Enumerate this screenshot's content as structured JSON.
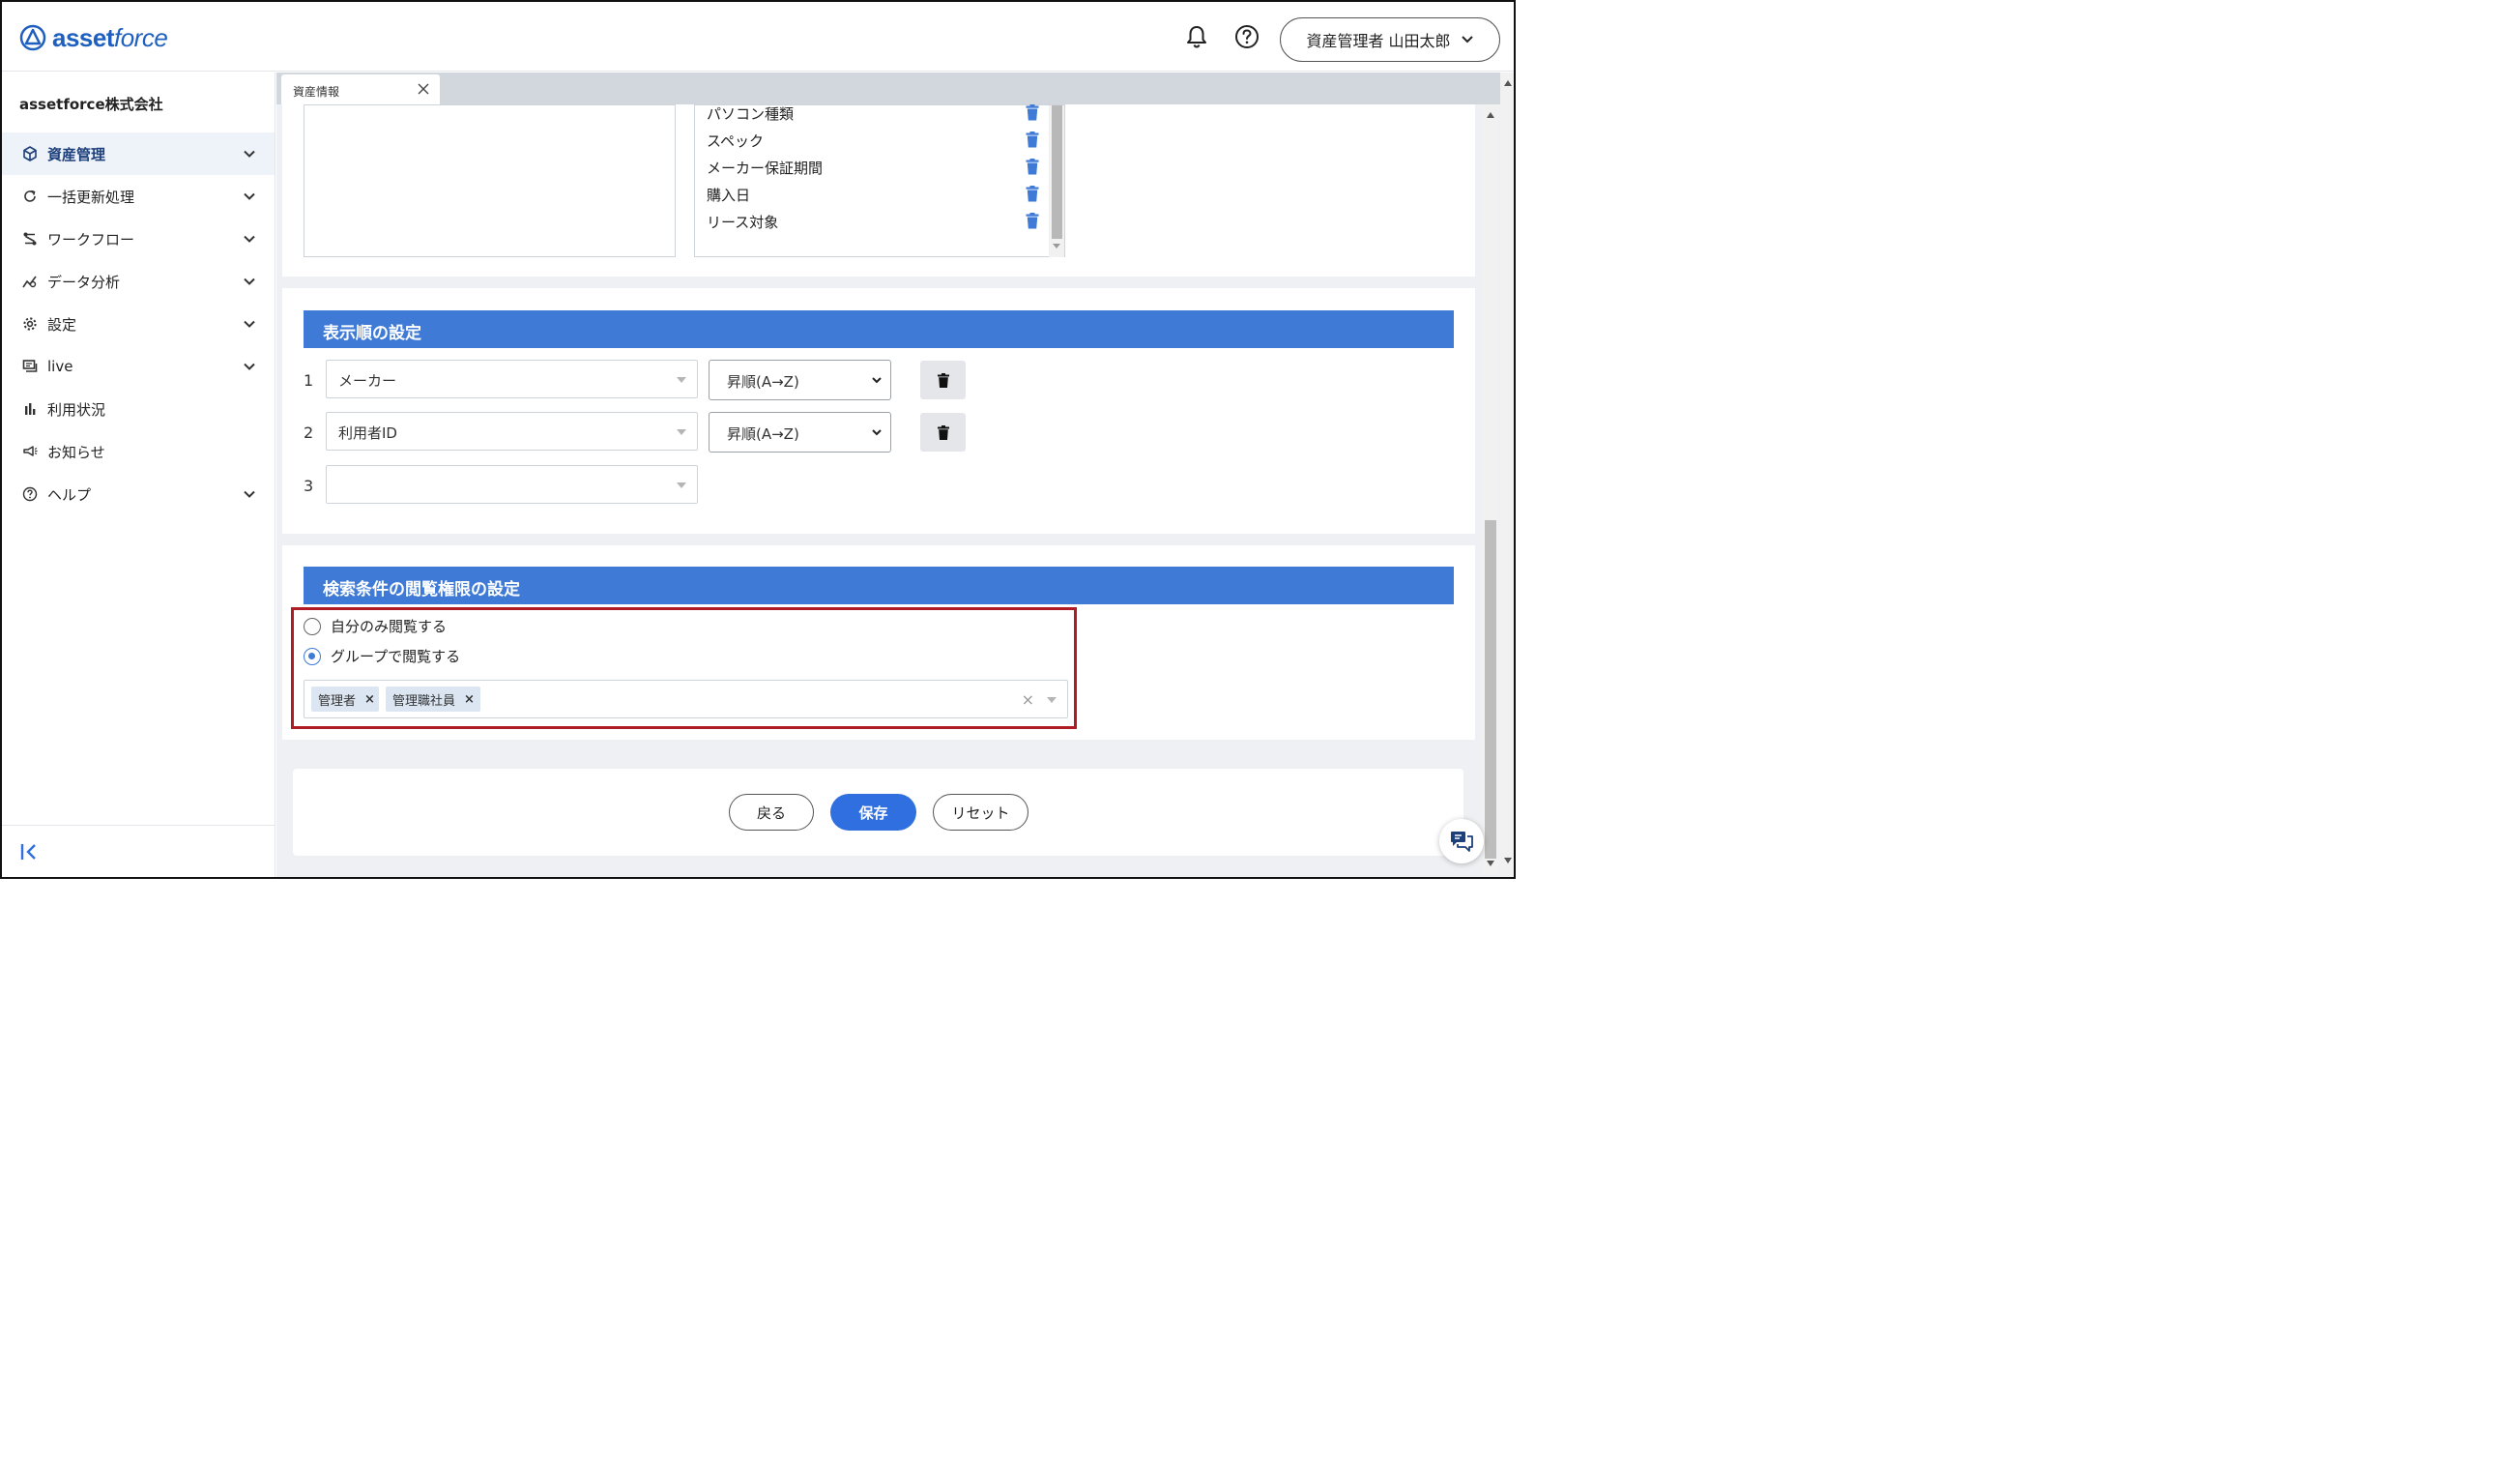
{
  "header": {
    "logo_text_bold": "asset",
    "logo_text_italic": "force",
    "user_label": "資産管理者 山田太郎"
  },
  "sidebar": {
    "company": "assetforce株式会社",
    "items": [
      {
        "label": "資産管理",
        "icon": "cube-icon",
        "active": true,
        "expandable": true
      },
      {
        "label": "一括更新処理",
        "icon": "refresh-icon",
        "expandable": true
      },
      {
        "label": "ワークフロー",
        "icon": "workflow-icon",
        "expandable": true
      },
      {
        "label": "データ分析",
        "icon": "analytics-icon",
        "expandable": true
      },
      {
        "label": "設定",
        "icon": "gear-icon",
        "expandable": true
      },
      {
        "label": "live",
        "icon": "live-icon",
        "expandable": true
      },
      {
        "label": "利用状況",
        "icon": "bar-chart-icon",
        "expandable": false
      },
      {
        "label": "お知らせ",
        "icon": "megaphone-icon",
        "expandable": false
      },
      {
        "label": "ヘルプ",
        "icon": "help-circle-icon",
        "expandable": true
      }
    ]
  },
  "tabs": [
    {
      "label": "資産情報"
    }
  ],
  "fields_list": {
    "items": [
      "パソコン種類",
      "スペック",
      "メーカー保証期間",
      "購入日",
      "リース対象"
    ]
  },
  "sort_section": {
    "title": "表示順の設定",
    "rows": [
      {
        "num": "1",
        "field": "メーカー",
        "order": "昇順(A→Z)"
      },
      {
        "num": "2",
        "field": "利用者ID",
        "order": "昇順(A→Z)"
      },
      {
        "num": "3",
        "field": "",
        "order": ""
      }
    ]
  },
  "permission_section": {
    "title": "検索条件の閲覧権限の設定",
    "options": [
      {
        "label": "自分のみ閲覧する",
        "checked": false
      },
      {
        "label": "グループで閲覧する",
        "checked": true
      }
    ],
    "groups": [
      "管理者",
      "管理職社員"
    ]
  },
  "actions": {
    "back": "戻る",
    "save": "保存",
    "reset": "リセット"
  },
  "colors": {
    "accent": "#3e7ad6",
    "primary_button": "#2f6fe0",
    "highlight_border": "#b01c24"
  }
}
